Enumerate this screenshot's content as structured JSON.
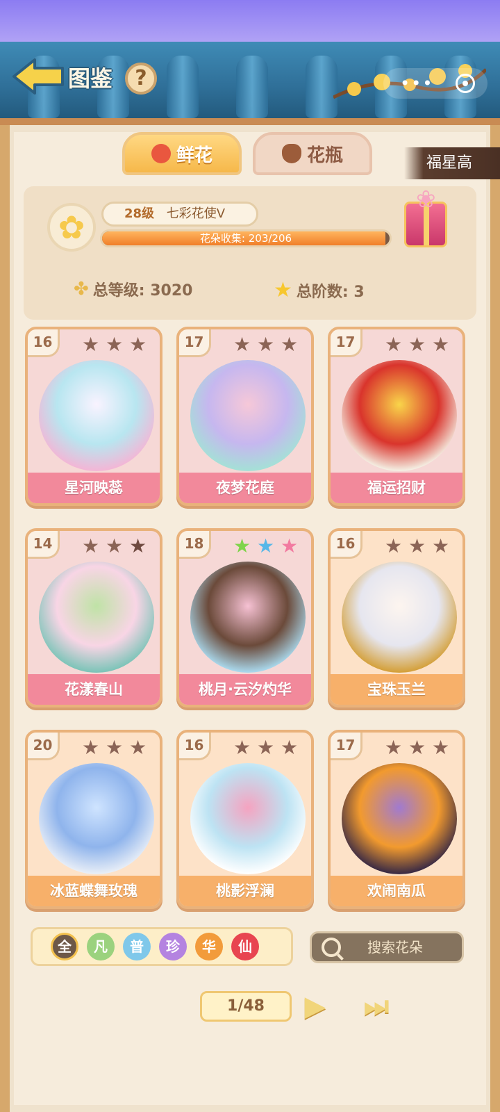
{
  "header": {
    "title": "图鉴",
    "help_label": "?"
  },
  "tabs": [
    {
      "label": "鲜花",
      "active": true
    },
    {
      "label": "花瓶",
      "active": false
    }
  ],
  "ribbon": "福星高",
  "profile": {
    "level_text": "28级",
    "rank_text": "七彩花使V",
    "collection_text": "花朵收集: 203/206",
    "collection_progress": 0.985,
    "total_level": "总等级: 3020",
    "total_stage": "总阶数: 3"
  },
  "cards": [
    {
      "level": "16",
      "name": "星河映蕊",
      "theme": "pink",
      "stars": [
        "#8b6456",
        "#8b6456",
        "#8b6456"
      ],
      "art": [
        "#f9f3ff",
        "#b8e6f0",
        "#f3b6d6"
      ]
    },
    {
      "level": "17",
      "name": "夜梦花庭",
      "theme": "pink",
      "stars": [
        "#8b6456",
        "#8b6456",
        "#8b6456"
      ],
      "art": [
        "#f6c8d8",
        "#c6b7ef",
        "#a5e0d7"
      ]
    },
    {
      "level": "17",
      "name": "福运招财",
      "theme": "pink",
      "stars": [
        "#8b6456",
        "#8b6456",
        "#8b6456"
      ],
      "art": [
        "#f9d54a",
        "#d9342c",
        "#f4efe3"
      ]
    },
    {
      "level": "14",
      "name": "花漾春山",
      "theme": "pink",
      "stars": [
        "#8b6456",
        "#8b6456",
        "#6f4a40"
      ],
      "art": [
        "#bfe3a6",
        "#f8d5e5",
        "#7cc4b8"
      ]
    },
    {
      "level": "18",
      "name": "桃月·云汐灼华",
      "theme": "pink",
      "stars": [
        "#7fd44a",
        "#56b7e8",
        "#f27aa0"
      ],
      "art": [
        "#f6c1d3",
        "#6b4a3a",
        "#a9d8ec"
      ]
    },
    {
      "level": "16",
      "name": "宝珠玉兰",
      "theme": "peach",
      "stars": [
        "#8b6456",
        "#8b6456",
        "#8b6456"
      ],
      "art": [
        "#fdf5ef",
        "#e6e6ef",
        "#d4a03a"
      ]
    },
    {
      "level": "20",
      "name": "冰蓝蝶舞玫瑰",
      "theme": "peach",
      "stars": [
        "#8b6456",
        "#8b6456",
        "#8b6456"
      ],
      "art": [
        "#cfe4ff",
        "#8fb4ec",
        "#e8eef7"
      ]
    },
    {
      "level": "16",
      "name": "桃影浮澜",
      "theme": "peach",
      "stars": [
        "#8b6456",
        "#8b6456",
        "#8b6456"
      ],
      "art": [
        "#f5a3c0",
        "#bde3f3",
        "#ffffff"
      ]
    },
    {
      "level": "17",
      "name": "欢闹南瓜",
      "theme": "peach",
      "stars": [
        "#8b6456",
        "#8b6456",
        "#8b6456"
      ],
      "art": [
        "#a07ad0",
        "#f29a2e",
        "#3a2a44"
      ]
    }
  ],
  "filters": [
    {
      "label": "全",
      "color": "#6d5848",
      "active": true
    },
    {
      "label": "凡",
      "color": "#9bd27e",
      "active": false
    },
    {
      "label": "普",
      "color": "#7fc8ea",
      "active": false
    },
    {
      "label": "珍",
      "color": "#b483e0",
      "active": false
    },
    {
      "label": "华",
      "color": "#f29b3b",
      "active": false
    },
    {
      "label": "仙",
      "color": "#e84550",
      "active": false
    }
  ],
  "search": {
    "placeholder": "搜索花朵"
  },
  "pager": {
    "page_text": "1/48"
  }
}
